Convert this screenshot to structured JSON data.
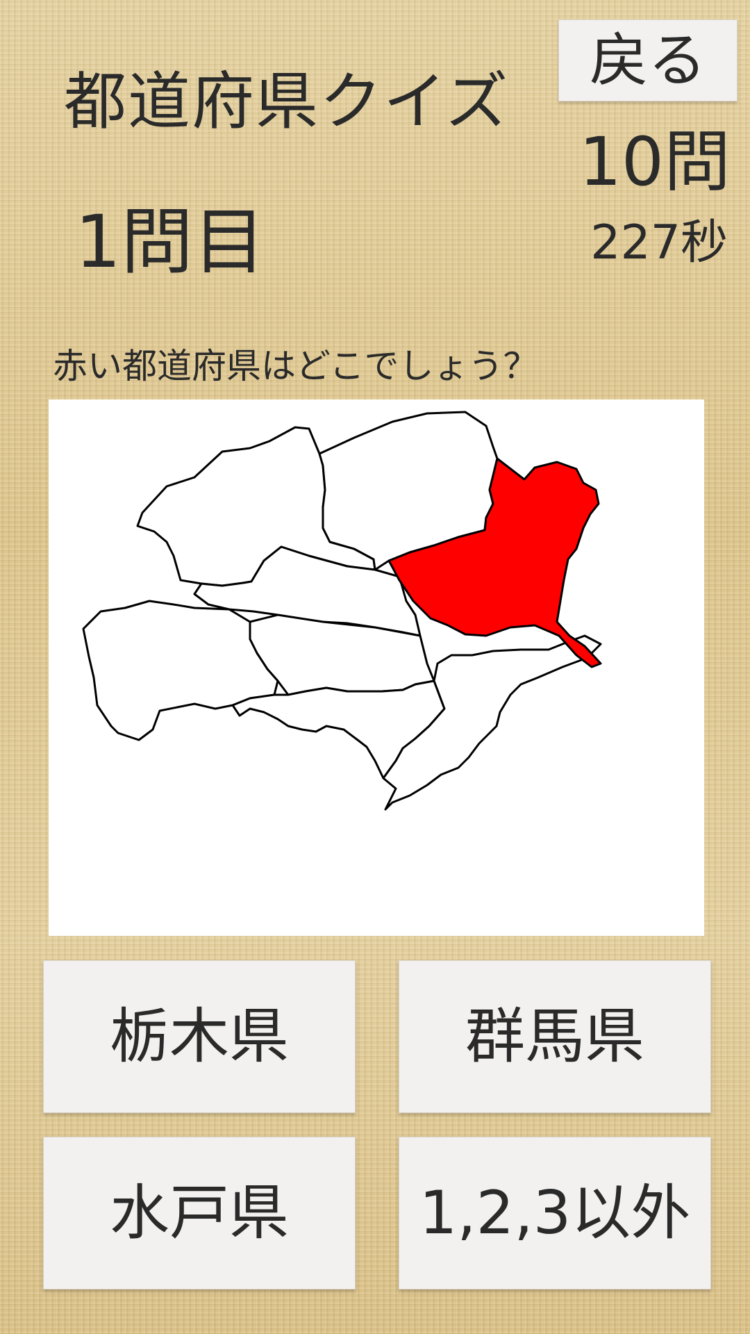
{
  "header": {
    "title": "都道府県クイズ",
    "back_label": "戻る",
    "total_questions": "10問",
    "question_number": "1問目",
    "timer": "227秒"
  },
  "question": {
    "prompt": "赤い都道府県はどこでしょう？"
  },
  "map": {
    "highlight_color": "#ff0000",
    "outline_color": "#000000",
    "fill_color": "#ffffff"
  },
  "answers": [
    {
      "label": "栃木県"
    },
    {
      "label": "群馬県"
    },
    {
      "label": "水戸県"
    },
    {
      "label": "1,2,3以外"
    }
  ]
}
